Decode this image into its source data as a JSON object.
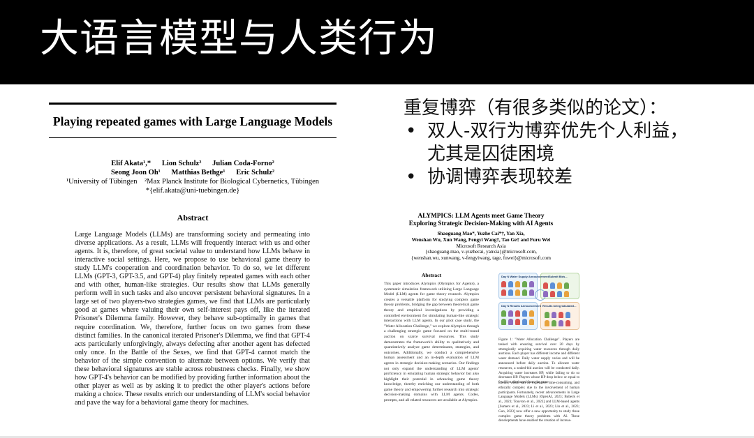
{
  "slide": {
    "title": "大语言模型与人类行为"
  },
  "paper1": {
    "title": "Playing repeated games with Large Language Models",
    "author_line1": "Elif Akata¹,*      Lion Schulz²      Julian Coda-Forno²",
    "author_line2": "Seong Joon Oh¹      Matthias Bethge¹      Eric Schulz²",
    "affiliation": "¹University of Tübingen    ²Max Planck Institute for Biological Cybernetics, Tübingen",
    "email": "*{elif.akata@uni-tuebingen.de}",
    "abstract_heading": "Abstract",
    "abstract": "Large Language Models (LLMs) are transforming society and permeating into diverse applications. As a result, LLMs will frequently interact with us and other agents. It is, therefore, of great societal value to understand how LLMs behave in interactive social settings. Here, we propose to use behavioral game theory to study LLM's cooperation and coordination behavior. To do so, we let different LLMs (GPT-3, GPT-3.5, and GPT-4) play finitely repeated games with each other and with other, human-like strategies. Our results show that LLMs generally perform well in such tasks and also uncover persistent behavioral signatures. In a large set of two players-two strategies games, we find that LLMs are particularly good at games where valuing their own self-interest pays off, like the iterated Prisoner's Dilemma family. However, they behave sub-optimally in games that require coordination. We, therefore, further focus on two games from these distinct families. In the canonical iterated Prisoner's Dilemma, we find that GPT-4 acts particularly unforgivingly, always defecting after another agent has defected only once. In the Battle of the Sexes, we find that GPT-4 cannot match the behavior of the simple convention to alternate between options. We verify that these behavioral signatures are stable across robustness checks. Finally, we show how GPT-4's behavior can be modified by providing further information about the other player as well as by asking it to predict the other player's actions before making a choice. These results enrich our understanding of LLM's social behavior and pave the way for a behavioral game theory for machines."
  },
  "bullets": {
    "heading": "重复博弈（有很多类似的论文）：",
    "items": [
      {
        "line1": "双人-双行为博弈优先个人利益，",
        "line2": "尤其是囚徒困境"
      },
      {
        "line1": "协调博弈表现较差",
        "line2": ""
      }
    ],
    "bullet_char": "•"
  },
  "paper2": {
    "title_line1": "ALYMPICS: LLM Agents meet Game Theory",
    "title_line2": "Exploring Strategic Decision-Making with AI Agents",
    "author_line1": "Shaoguang Mao*, Yuzhe Cai*†, Yan Xia,",
    "author_line2": "Wenshan Wu, Xun Wang, Fengyi Wang†, Tao Ge† and Furu Wei",
    "affiliation": "Microsoft Research Asia",
    "email1": "{shaoguang.mao, v-yuzhecai, yanxia}@microsoft.com,",
    "email2": "{wenshan.wu, xunwang, v-fengyiwang, tage, fuwei}@microsoft.com",
    "abstract_heading": "Abstract",
    "abstract": "This paper introduces Alympics (Olympics for Agents), a systematic simulation framework utilizing Large Language Model (LLM) agents for game theory research. Alympics creates a versatile platform for studying complex game theory problems, bridging the gap between theoretical game theory and empirical investigations by providing a controlled environment for simulating human-like strategic interactions with LLM agents. In our pilot case study, the \"Water Allocation Challenge,\" we explore Alympics through a challenging strategic game focused on the multi-round auction on scarce survival resources. This study demonstrates the framework's ability to qualitatively and quantitatively analyze game determinants, strategies, and outcomes. Additionally, we conduct a comprehensive human assessment and an in-depth evaluation of LLM agents in strategic decision-making scenarios. Our findings not only expand the understanding of LLM agents' proficiency in emulating human strategic behavior but also highlight their potential in advancing game theory knowledge, thereby enriching our understanding of both game theory and empowering further research into strategic decision-making domains with LLM agents. Codes, prompts, and all related resources are available at Alympics.",
    "figure_labels": {
      "supply": "Day N Water Supply Announcement",
      "submit": "Submit Bids...",
      "bids": "Day N Results Announcement",
      "results": "Results being tabulated..."
    },
    "caption": "Figure 1: \"Water Allocation Challenge\". Players are tasked with ensuring survival over 20 days by strategically acquiring water resources through daily auctions. Each player has different income and different water demand. Daily water supply varies and will be announced before daily auction. To allocate water resources, a sealed-bid auction will be conducted daily. Acquiring water increases HP, while failing to do so decreases HP. Players whose HP drop below or equal to 0 will be eliminated from the game.",
    "body": "iments, which can be expensive, time-consuming, and ethically complex due to the involvement of human participants. Fortunately, recent advancements in Large Language Models (LLMs) [OpenAI, 2023; Bubeck et al., 2023; Touvron et al., 2023] and LLM-based agents [Sumers et al., 2023; Li et al., 2023; Lin et al., 2023; Guo, 2023] now offer a new opportunity to study these complex game theory problems with AI. These developments have enabled the creation of increas-"
  },
  "colors": {
    "header_bg": "#000000",
    "title_text": "#ffffff",
    "body_text": "#111111"
  }
}
